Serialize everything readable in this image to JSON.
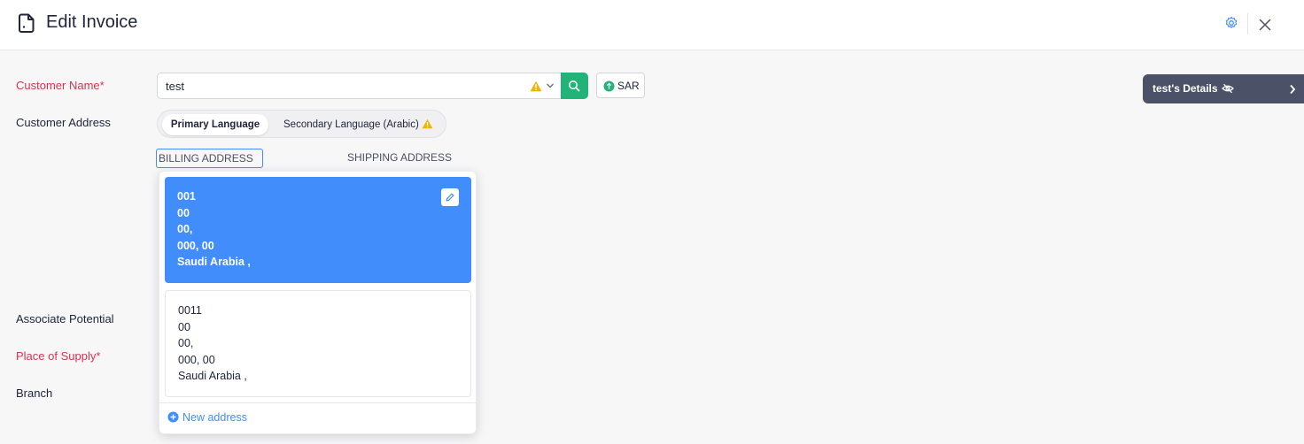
{
  "header": {
    "title": "Edit Invoice"
  },
  "form": {
    "customer_name_label": "Customer Name*",
    "customer_name_value": "test",
    "currency": "SAR",
    "customer_address_label": "Customer Address",
    "associate_potential_label": "Associate Potential",
    "place_of_supply_label": "Place of Supply*",
    "branch_label": "Branch"
  },
  "language_toggle": {
    "primary": "Primary Language",
    "secondary": "Secondary Language (Arabic)"
  },
  "address_tabs": {
    "billing": "BILLING ADDRESS",
    "shipping": "SHIPPING ADDRESS"
  },
  "address_dropdown": {
    "addresses": [
      {
        "line1": "001",
        "line2": "00",
        "line3": "00,",
        "line4": "000, 00",
        "line5": "Saudi Arabia ,"
      },
      {
        "line1": "0011",
        "line2": "00",
        "line3": "00,",
        "line4": "000, 00",
        "line5": "Saudi Arabia ,"
      }
    ],
    "new_address": "New address"
  },
  "details_panel": {
    "title": "test's Details"
  },
  "colors": {
    "accent_blue": "#408dfb",
    "search_green": "#22b378",
    "required_red": "#d6334f",
    "details_bg": "#4b5167",
    "warning_yellow": "#f0b400"
  }
}
